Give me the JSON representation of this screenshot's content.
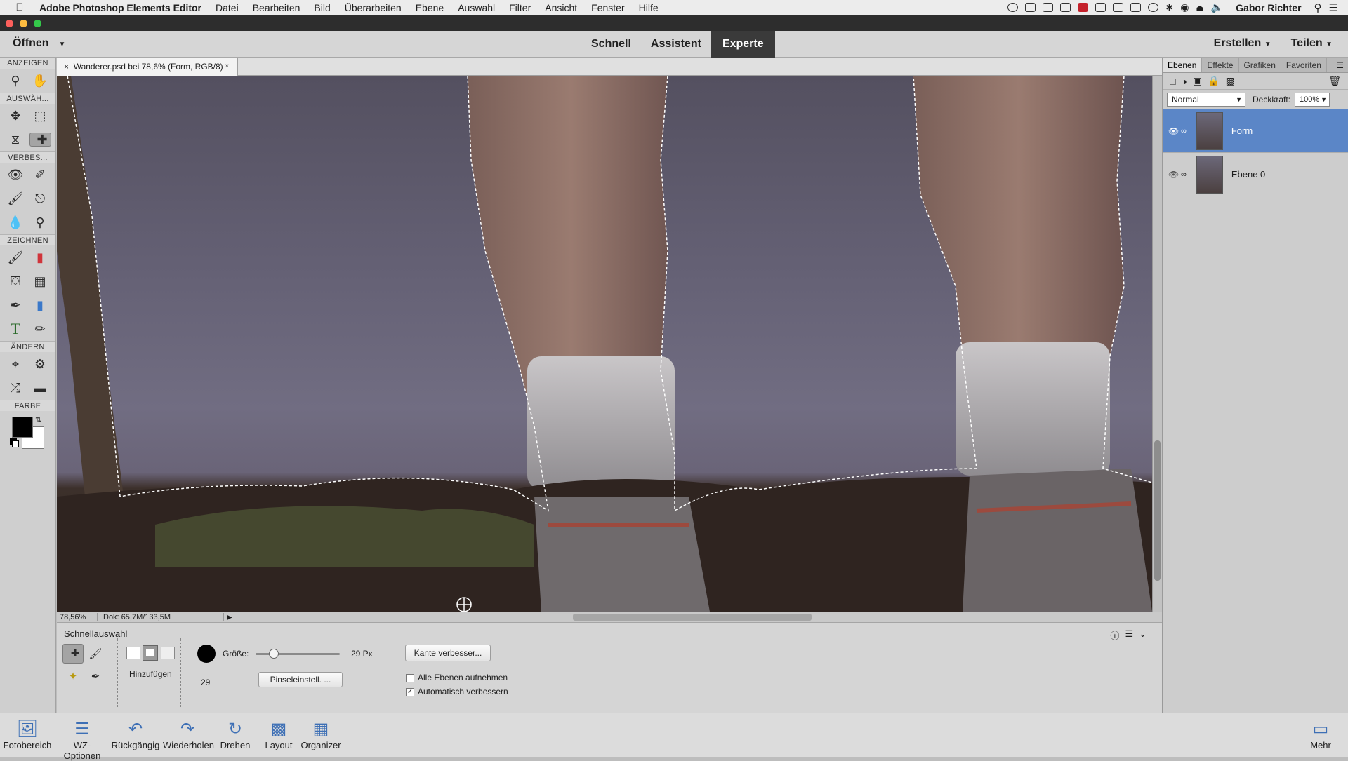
{
  "menubar": {
    "app_name": "Adobe Photoshop Elements Editor",
    "items": [
      "Datei",
      "Bearbeiten",
      "Bild",
      "Überarbeiten",
      "Ebene",
      "Auswahl",
      "Filter",
      "Ansicht",
      "Fenster",
      "Hilfe"
    ],
    "user": "Gabor Richter"
  },
  "topbar": {
    "open_label": "Öffnen",
    "modes": [
      "Schnell",
      "Assistent",
      "Experte"
    ],
    "active_mode": "Experte",
    "create_label": "Erstellen",
    "share_label": "Teilen"
  },
  "toolbox": {
    "sections": {
      "view": "ANZEIGEN",
      "select": "AUSWÄH...",
      "enhance": "VERBES...",
      "draw": "ZEICHNEN",
      "modify": "ÄNDERN",
      "color": "FARBE"
    },
    "foreground_color": "#000000",
    "background_color": "#ffffff"
  },
  "document": {
    "tab_title": "Wanderer.psd bei 78,6% (Form, RGB/8) *",
    "zoom": "78,56%",
    "doc_info": "Dok: 65,7M/133,5M"
  },
  "options": {
    "tool_name": "Schnellauswahl",
    "mode_label": "Hinzufügen",
    "size_label": "Größe:",
    "size_value": "29 Px",
    "size_number": "29",
    "size_slider_fraction": 0.22,
    "brush_settings_label": "Pinseleinstell. ...",
    "refine_edge_label": "Kante verbesser...",
    "sample_all_label": "Alle Ebenen aufnehmen",
    "sample_all_checked": false,
    "auto_enhance_label": "Automatisch verbessern",
    "auto_enhance_checked": true
  },
  "layers_panel": {
    "tabs": [
      "Ebenen",
      "Effekte",
      "Grafiken",
      "Favoriten"
    ],
    "blend_mode": "Normal",
    "opacity_label": "Deckkraft:",
    "opacity_value": "100%",
    "layers": [
      {
        "name": "Form",
        "visible": true,
        "selected": true
      },
      {
        "name": "Ebene 0",
        "visible": false,
        "selected": false
      }
    ]
  },
  "taskbar": {
    "items": [
      "Fotobereich",
      "WZ-Optionen",
      "Rückgängig",
      "Wiederholen",
      "Drehen",
      "Layout",
      "Organizer"
    ],
    "more_label": "Mehr"
  },
  "colors": {
    "accent": "#5b86c7",
    "active_mode_bg": "#3a3a3a"
  }
}
